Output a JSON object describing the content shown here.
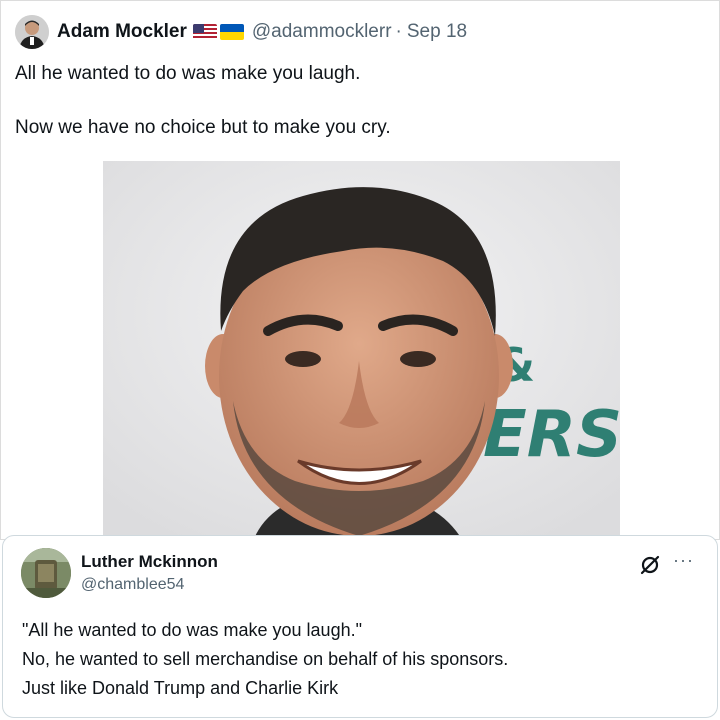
{
  "tweet": {
    "display_name": "Adam Mockler",
    "handle": "@adammocklerr",
    "separator": "·",
    "date": "Sep 18",
    "flags": [
      "us-flag-icon",
      "ukraine-flag-icon"
    ],
    "text_line1": "All he wanted to do was make you laugh.",
    "text_line2": "Now we have no choice but to make you cry.",
    "photo_sign_text_1": "&",
    "photo_sign_text_2": "ERS"
  },
  "reply": {
    "display_name": "Luther Mckinnon",
    "handle": "@chamblee54",
    "more_label": "···",
    "text_lines": [
      "\"All he wanted to do was make you laugh.\"",
      "No, he wanted to sell merchandise on behalf of his sponsors.",
      "Just like Donald Trump and Charlie Kirk"
    ]
  },
  "colors": {
    "text_primary": "#0f1419",
    "text_secondary": "#536471",
    "border": "#cfd9de",
    "sign_teal": "#2f7f73"
  }
}
